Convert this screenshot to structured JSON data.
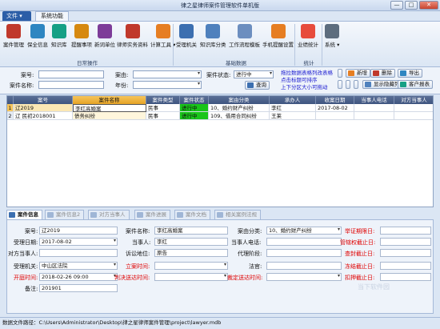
{
  "window": {
    "title": "律之星律师案件管理软件单机版",
    "minimize_glyph": "—",
    "maximize_glyph": "□",
    "close_glyph": "✕"
  },
  "menubar": {
    "file_label": "文件",
    "tab_label": "系统功能"
  },
  "ribbon": {
    "groups": [
      {
        "label": "日常操作",
        "items": [
          "案件管理",
          "保全信息",
          "知识库",
          "提醒事项",
          "新词单位",
          "律师实务资料",
          "计算工具"
        ]
      },
      {
        "label": "基础数据",
        "items": [
          "受理机关",
          "知识库分类",
          "工作流程模板",
          "手机提醒设置"
        ]
      },
      {
        "label": "统计",
        "items": [
          "业绩统计"
        ]
      },
      {
        "label": "",
        "items": [
          "系统"
        ]
      }
    ],
    "icon_colors": [
      "#c0392b",
      "#2e86c1",
      "#16a085",
      "#d68910",
      "#7d3c98",
      "#c0392b",
      "#e67e22",
      "#3c6fb0",
      "#4f81bd",
      "#6c8ebf",
      "#e67e22",
      "#e74c3c",
      "#5d6d7e"
    ]
  },
  "search": {
    "case_no_label": "案号:",
    "case_name_label": "案件名称:",
    "case_cause_label": "案由:",
    "year_label": "年份:",
    "status_label": "案件状态:",
    "status_value": "进行中",
    "query_label": "查询",
    "hint1": "拖拉数据表格列改表格",
    "hint2": "点击标题可排序",
    "hint3": "上下分区大小可拖动",
    "buttons": [
      "新增",
      "删除",
      "导出",
      "显示隐藏列",
      "客户报表"
    ]
  },
  "grid": {
    "columns": [
      "案号",
      "案件名称",
      "案件类型",
      "案件状态",
      "案由分类",
      "承办人",
      "收案日期",
      "当事人电话",
      "对方当事人"
    ],
    "rows": [
      {
        "num": "1",
        "cells": [
          "辽2019",
          "李红高婚案",
          "民事",
          "进行中",
          "10、婚约财产纠纷",
          "李红",
          "2017-08-02",
          "",
          ""
        ]
      },
      {
        "num": "2",
        "cells": [
          "辽 民初2018001",
          "债务纠纷",
          "民事",
          "进行中",
          "109、借用合同纠纷",
          "王莱",
          "",
          "",
          ""
        ]
      }
    ]
  },
  "detail_tabs": [
    "案件信息",
    "案件信息2",
    "对方当事人",
    "案件进展",
    "案件文档",
    "相关案例法规"
  ],
  "detail": {
    "case_no_label": "案号:",
    "case_no_value": "辽2019",
    "accept_date_label": "受理日期:",
    "accept_date_value": "2017-08-02",
    "opposing_label": "对方当事人:",
    "opposing_value": "",
    "agency_label": "受理机关:",
    "agency_value": "中山区法院",
    "court_time_label": "开庭时间:",
    "court_time_value": "2018-02-26 09:00",
    "remark_label": "备注:",
    "remark_value": "201901",
    "case_name_label": "案件名称:",
    "case_name_value": "李红高婚案",
    "party_label": "当事人:",
    "party_value": "李红",
    "litigation_label": "诉讼地位:",
    "litigation_value": "原告",
    "serve_time_label": "立案时间:",
    "judge_time_label": "判决送达时间:",
    "cause_label": "案由分类:",
    "cause_value": "10、婚约财产纠纷",
    "party_phone_label": "当事人电话:",
    "agent_label": "代理阶段:",
    "court_label": "法官:",
    "ruling_time_label": "裁定送达时间:",
    "appeal_label": "举证期限日:",
    "jurisdiction_label": "管辖权截止日:",
    "inquiry_label": "查封截止日:",
    "freeze_label": "冻结截止日:",
    "seize_label": "扣押截止日:"
  },
  "statusbar": {
    "text": "数据文件路径：C:\\Users\\Administrator\\Desktop\\律之星律师案件管理\\project\\lawyer.mdb"
  },
  "watermark": "当下软件园"
}
